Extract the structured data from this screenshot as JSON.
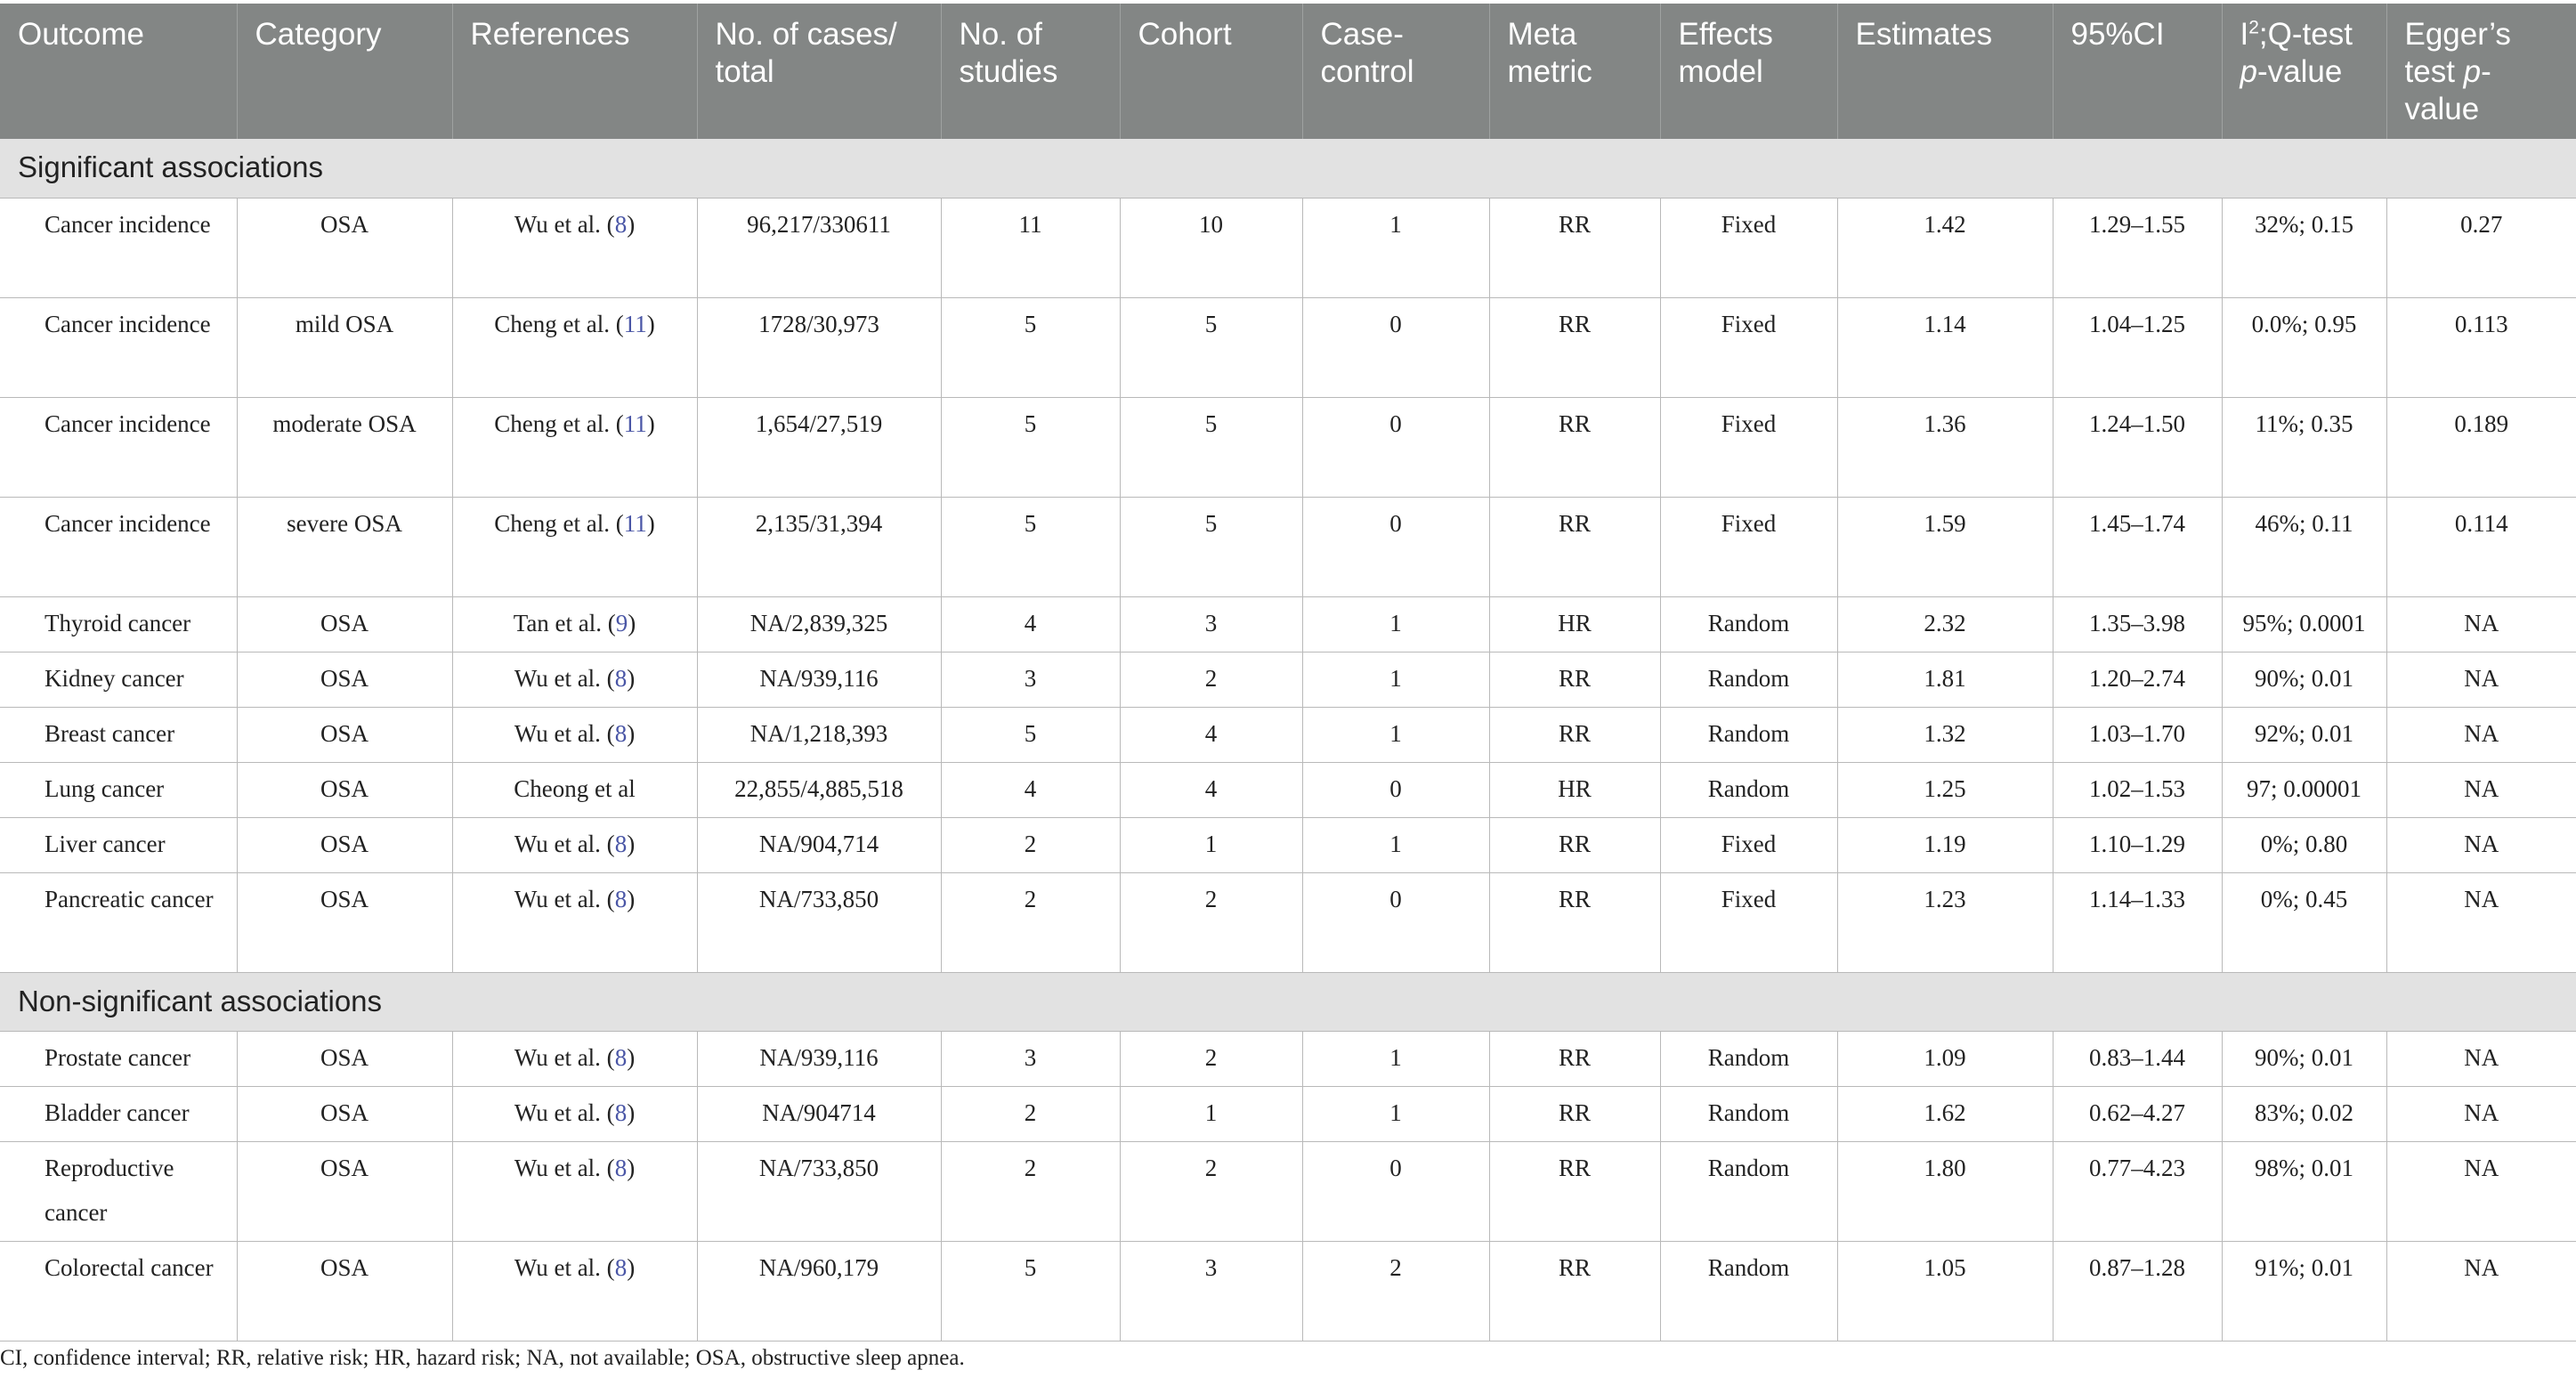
{
  "headers": {
    "outcome": "Outcome",
    "category": "Category",
    "references": "References",
    "cases_total": "No. of cases/ total",
    "studies": "No. of studies",
    "cohort": "Cohort",
    "case_control": "Case-control",
    "meta_metric": "Meta metric",
    "effects_model": "Effects model",
    "estimates": "Estimates",
    "ci": "95%CI",
    "i2_a": "I",
    "i2_sup": "2",
    "i2_b": ";Q-test ",
    "i2_p": "p",
    "i2_c": "-value",
    "egger_a": "Egger’s test ",
    "egger_p": "p",
    "egger_b": "-value"
  },
  "sections": [
    {
      "title": "Significant associations",
      "rows": [
        {
          "outcome": "Cancer incidence",
          "category": "OSA",
          "ref_author": "Wu et al. (",
          "ref_num": "8",
          "ref_close": ")",
          "cases_total": "96,217/330611",
          "studies": "11",
          "cohort": "10",
          "case_control": "1",
          "metric": "RR",
          "model": "Fixed",
          "estimate": "1.42",
          "ci": "1.29–1.55",
          "i2q": "32%; 0.15",
          "egger": "0.27"
        },
        {
          "outcome": "Cancer incidence",
          "category": "mild OSA",
          "ref_author": "Cheng et al. (",
          "ref_num": "11",
          "ref_close": ")",
          "cases_total": "1728/30,973",
          "studies": "5",
          "cohort": "5",
          "case_control": "0",
          "metric": "RR",
          "model": "Fixed",
          "estimate": "1.14",
          "ci": "1.04–1.25",
          "i2q": "0.0%; 0.95",
          "egger": "0.113"
        },
        {
          "outcome": "Cancer incidence",
          "category": "moderate OSA",
          "ref_author": "Cheng et al. (",
          "ref_num": "11",
          "ref_close": ")",
          "cases_total": "1,654/27,519",
          "studies": "5",
          "cohort": "5",
          "case_control": "0",
          "metric": "RR",
          "model": "Fixed",
          "estimate": "1.36",
          "ci": "1.24–1.50",
          "i2q": "11%; 0.35",
          "egger": "0.189"
        },
        {
          "outcome": "Cancer incidence",
          "category": "severe OSA",
          "ref_author": "Cheng et al. (",
          "ref_num": "11",
          "ref_close": ")",
          "cases_total": "2,135/31,394",
          "studies": "5",
          "cohort": "5",
          "case_control": "0",
          "metric": "RR",
          "model": "Fixed",
          "estimate": "1.59",
          "ci": "1.45–1.74",
          "i2q": "46%; 0.11",
          "egger": "0.114"
        },
        {
          "outcome": "Thyroid cancer",
          "category": "OSA",
          "ref_author": "Tan et al. (",
          "ref_num": "9",
          "ref_close": ")",
          "cases_total": "NA/2,839,325",
          "studies": "4",
          "cohort": "3",
          "case_control": "1",
          "metric": "HR",
          "model": "Random",
          "estimate": "2.32",
          "ci": "1.35–3.98",
          "i2q": "95%; 0.0001",
          "egger": "NA"
        },
        {
          "outcome": "Kidney cancer",
          "category": "OSA",
          "ref_author": "Wu et al. (",
          "ref_num": "8",
          "ref_close": ")",
          "cases_total": "NA/939,116",
          "studies": "3",
          "cohort": "2",
          "case_control": "1",
          "metric": "RR",
          "model": "Random",
          "estimate": "1.81",
          "ci": "1.20–2.74",
          "i2q": "90%; 0.01",
          "egger": "NA"
        },
        {
          "outcome": "Breast cancer",
          "category": "OSA",
          "ref_author": "Wu et al. (",
          "ref_num": "8",
          "ref_close": ")",
          "cases_total": "NA/1,218,393",
          "studies": "5",
          "cohort": "4",
          "case_control": "1",
          "metric": "RR",
          "model": "Random",
          "estimate": "1.32",
          "ci": "1.03–1.70",
          "i2q": "92%; 0.01",
          "egger": "NA"
        },
        {
          "outcome": "Lung cancer",
          "category": "OSA",
          "ref_author": "Cheong et al",
          "ref_num": "",
          "ref_close": "",
          "cases_total": "22,855/4,885,518",
          "studies": "4",
          "cohort": "4",
          "case_control": "0",
          "metric": "HR",
          "model": "Random",
          "estimate": "1.25",
          "ci": "1.02–1.53",
          "i2q": "97; 0.00001",
          "egger": "NA"
        },
        {
          "outcome": "Liver cancer",
          "category": "OSA",
          "ref_author": "Wu et al. (",
          "ref_num": "8",
          "ref_close": ")",
          "cases_total": "NA/904,714",
          "studies": "2",
          "cohort": "1",
          "case_control": "1",
          "metric": "RR",
          "model": "Fixed",
          "estimate": "1.19",
          "ci": "1.10–1.29",
          "i2q": "0%; 0.80",
          "egger": "NA"
        },
        {
          "outcome": "Pancreatic cancer",
          "category": "OSA",
          "ref_author": "Wu et al. (",
          "ref_num": "8",
          "ref_close": ")",
          "cases_total": "NA/733,850",
          "studies": "2",
          "cohort": "2",
          "case_control": "0",
          "metric": "RR",
          "model": "Fixed",
          "estimate": "1.23",
          "ci": "1.14–1.33",
          "i2q": "0%; 0.45",
          "egger": "NA"
        }
      ]
    },
    {
      "title": "Non-significant associations",
      "rows": [
        {
          "outcome": "Prostate cancer",
          "category": "OSA",
          "ref_author": "Wu et al. (",
          "ref_num": "8",
          "ref_close": ")",
          "cases_total": "NA/939,116",
          "studies": "3",
          "cohort": "2",
          "case_control": "1",
          "metric": "RR",
          "model": "Random",
          "estimate": "1.09",
          "ci": "0.83–1.44",
          "i2q": "90%; 0.01",
          "egger": "NA"
        },
        {
          "outcome": "Bladder cancer",
          "category": "OSA",
          "ref_author": "Wu et al. (",
          "ref_num": "8",
          "ref_close": ")",
          "cases_total": "NA/904714",
          "studies": "2",
          "cohort": "1",
          "case_control": "1",
          "metric": "RR",
          "model": "Random",
          "estimate": "1.62",
          "ci": "0.62–4.27",
          "i2q": "83%; 0.02",
          "egger": "NA"
        },
        {
          "outcome": "Reproductive cancer",
          "category": "OSA",
          "ref_author": "Wu et al. (",
          "ref_num": "8",
          "ref_close": ")",
          "cases_total": "NA/733,850",
          "studies": "2",
          "cohort": "2",
          "case_control": "0",
          "metric": "RR",
          "model": "Random",
          "estimate": "1.80",
          "ci": "0.77–4.23",
          "i2q": "98%; 0.01",
          "egger": "NA"
        },
        {
          "outcome": "Colorectal cancer",
          "category": "OSA",
          "ref_author": "Wu et al. (",
          "ref_num": "8",
          "ref_close": ")",
          "cases_total": "NA/960,179",
          "studies": "5",
          "cohort": "3",
          "case_control": "2",
          "metric": "RR",
          "model": "Random",
          "estimate": "1.05",
          "ci": "0.87–1.28",
          "i2q": "91%; 0.01",
          "egger": "NA"
        }
      ]
    }
  ],
  "footnote": "CI, confidence interval; RR, relative risk; HR, hazard risk; NA, not available; OSA, obstructive sleep apnea."
}
